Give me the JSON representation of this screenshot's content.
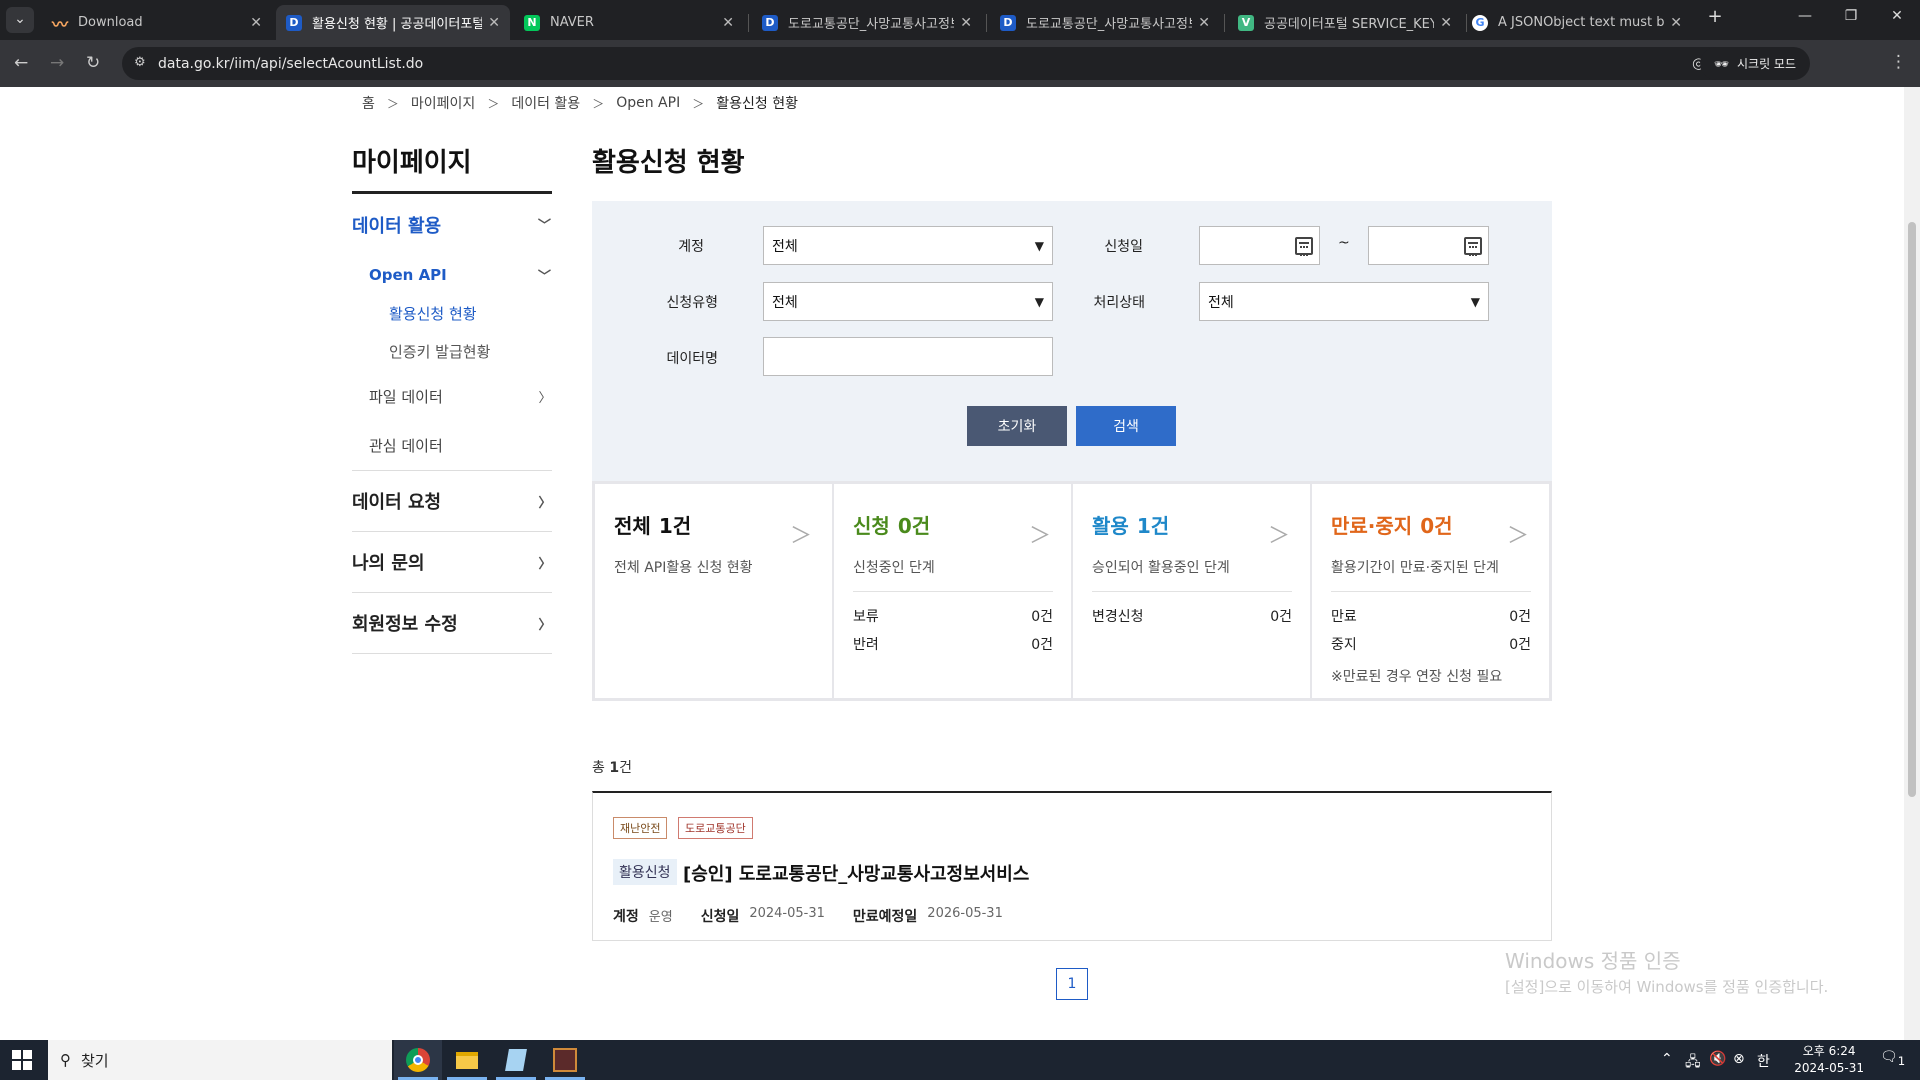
{
  "browser": {
    "tabs": [
      {
        "title": "Download",
        "favicon": "download-favicon",
        "active": false
      },
      {
        "title": "활용신청 현황 | 공공데이터포털",
        "favicon": "data-go-kr-favicon",
        "active": true
      },
      {
        "title": "NAVER",
        "favicon": "naver-favicon",
        "active": false
      },
      {
        "title": "도로교통공단_사망교통사고정보",
        "favicon": "data-go-kr-favicon",
        "active": false
      },
      {
        "title": "도로교통공단_사망교통사고정보",
        "favicon": "data-go-kr-favicon",
        "active": false
      },
      {
        "title": "공공데이터포털 SERVICE_KEY_I",
        "favicon": "vuejs-favicon",
        "active": false
      },
      {
        "title": "A JSONObject text must begin",
        "favicon": "google-favicon",
        "active": false
      }
    ],
    "url": "data.go.kr/iim/api/selectAcountList.do",
    "incognito_label": "시크릿 모드"
  },
  "breadcrumb": [
    "홈",
    "마이페이지",
    "데이터 활용",
    "Open API",
    "활용신청 현황"
  ],
  "sidebar": {
    "title": "마이페이지",
    "data_use": "데이터 활용",
    "open_api": "Open API",
    "apply_status": "활용신청 현황",
    "key_status": "인증키 발급현황",
    "file_data": "파일 데이터",
    "interest_data": "관심 데이터",
    "data_request": "데이터 요청",
    "my_inquiry": "나의 문의",
    "member_edit": "회원정보 수정"
  },
  "main": {
    "title": "활용신청 현황"
  },
  "filter": {
    "account_label": "계정",
    "account_value": "전체",
    "apply_date_label": "신청일",
    "tilde": "~",
    "apply_type_label": "신청유형",
    "apply_type_value": "전체",
    "status_label": "처리상태",
    "status_value": "전체",
    "data_name_label": "데이터명",
    "data_name_value": "",
    "reset": "초기화",
    "search": "검색"
  },
  "summary": {
    "all": {
      "title": "전체",
      "count": "1건",
      "desc": "전체 API활용 신청 현황"
    },
    "apply": {
      "title": "신청",
      "count": "0건",
      "desc": "신청중인 단계",
      "rows": [
        {
          "k": "보류",
          "v": "0건"
        },
        {
          "k": "반려",
          "v": "0건"
        }
      ]
    },
    "use": {
      "title": "활용",
      "count": "1건",
      "desc": "승인되어 활용중인 단계",
      "rows": [
        {
          "k": "변경신청",
          "v": "0건"
        }
      ]
    },
    "expire": {
      "title": "만료·중지",
      "count": "0건",
      "desc": "활용기간이 만료·중지된 단계",
      "rows": [
        {
          "k": "만료",
          "v": "0건"
        },
        {
          "k": "중지",
          "v": "0건"
        }
      ],
      "note": "※만료된 경우 연장 신청 필요"
    },
    "colors": {
      "apply": "#4a8a1c",
      "use": "#1f88c9",
      "expire": "#e0661a"
    }
  },
  "list": {
    "total_prefix": "총 ",
    "total_count": "1",
    "total_suffix": "건",
    "item": {
      "tag1": "재난안전",
      "tag2": "도로교통공단",
      "badge": "활용신청",
      "title": "[승인] 도로교통공단_사망교통사고정보서비스",
      "account_label": "계정",
      "account_value": "운영",
      "apply_date_label": "신청일",
      "apply_date_value": "2024-05-31",
      "expire_label": "만료예정일",
      "expire_value": "2026-05-31"
    },
    "page": "1"
  },
  "watermark": {
    "line1": "Windows 정품 인증",
    "line2": "[설정]으로 이동하여 Windows를 정품 인증합니다."
  },
  "taskbar": {
    "search_placeholder": "찾기",
    "time": "오후 6:24",
    "date": "2024-05-31",
    "notification_count": "1"
  }
}
